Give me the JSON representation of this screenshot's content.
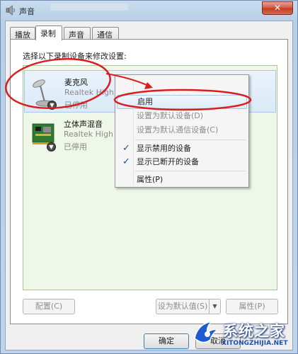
{
  "window": {
    "title": "声音",
    "close_glyph": "✕"
  },
  "tabs": [
    {
      "label": "播放",
      "active": false
    },
    {
      "label": "录制",
      "active": true
    },
    {
      "label": "声音",
      "active": false
    },
    {
      "label": "通信",
      "active": false
    }
  ],
  "instruction": "选择以下录制设备来修改设置:",
  "devices": [
    {
      "name": "麦克风",
      "description": "Realtek High Definition Audio",
      "status": "已停用",
      "icon": "microphone-icon",
      "selected": true
    },
    {
      "name": "立体声混音",
      "description": "Realtek High Definition Audio",
      "status": "已停用",
      "icon": "sound-card-icon",
      "selected": false
    }
  ],
  "context_menu": {
    "items": [
      {
        "label": "启用",
        "enabled": true,
        "checked": false,
        "hover": true
      },
      {
        "label": "设置为默认设备(D)",
        "enabled": false,
        "checked": false
      },
      {
        "label": "设置为默认通信设备(C)",
        "enabled": false,
        "checked": false
      },
      {
        "label": "显示禁用的设备",
        "enabled": true,
        "checked": true
      },
      {
        "label": "显示已断开的设备",
        "enabled": true,
        "checked": true
      },
      {
        "label": "属性(P)",
        "enabled": true,
        "checked": false
      }
    ]
  },
  "buttons": {
    "configure": "配置(C)",
    "set_default": "设为默认值(S)",
    "properties": "属性(P)",
    "ok": "确定",
    "cancel": "取消"
  },
  "watermark": {
    "cn": "系统之家",
    "en": "XITONGZHIJIA.NET"
  },
  "colors": {
    "annotation_red": "#d81e1e",
    "list_background": "#eef7e8",
    "selection": "#d9eaf8"
  }
}
